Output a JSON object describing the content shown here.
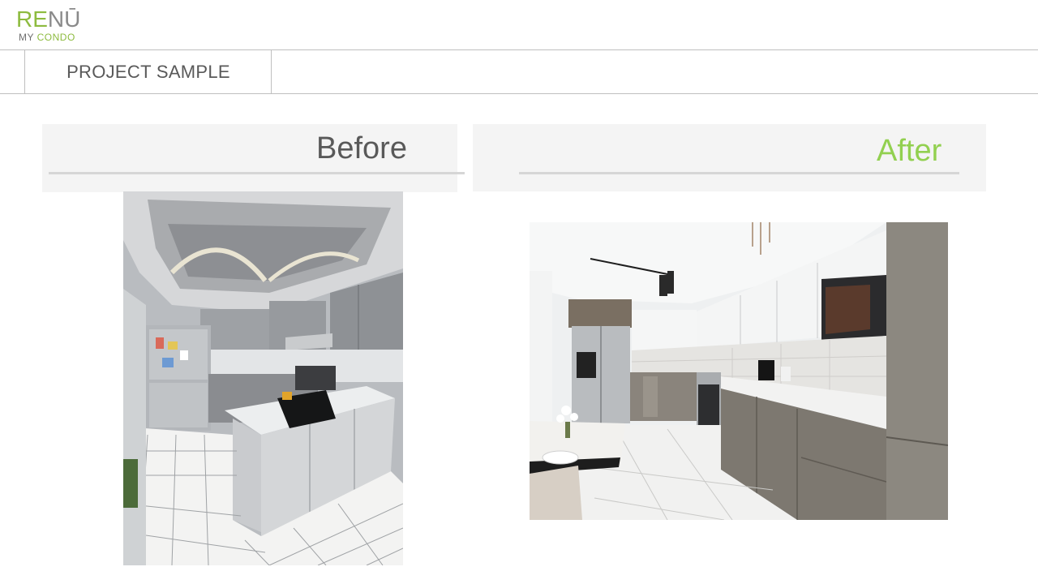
{
  "logo": {
    "brand_part1": "RE",
    "brand_part2": "NŪ",
    "tagline_part1": "MY ",
    "tagline_part2": "CONDO"
  },
  "page": {
    "title": "PROJECT SAMPLE"
  },
  "before": {
    "heading": "Before",
    "photo_description": "kitchen-before-photo"
  },
  "after": {
    "heading": "After",
    "photo_description": "kitchen-after-photo"
  },
  "colors": {
    "brand_green": "#8dbb3f",
    "after_green": "#92d050",
    "heading_gray": "#595959",
    "panel_bg": "#f4f4f4"
  }
}
